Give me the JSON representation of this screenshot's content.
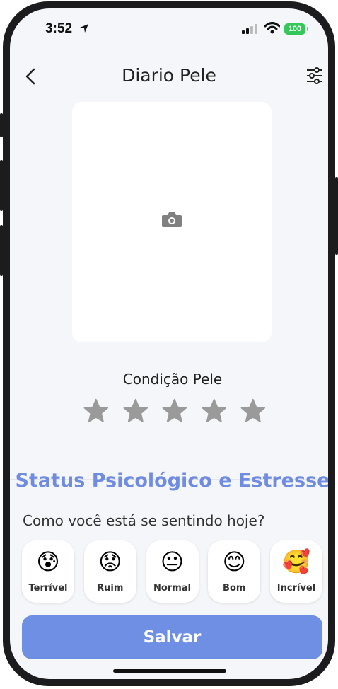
{
  "status_bar": {
    "time": "3:52",
    "battery": "100"
  },
  "header": {
    "title": "Diario Pele"
  },
  "photo": {
    "icon": "camera-icon"
  },
  "skin_condition": {
    "label": "Condição Pele",
    "stars_total": 5,
    "stars_selected": 0
  },
  "psych": {
    "title": "Status Psicológico e Estresse",
    "question": "Como você está se sentindo hoje?",
    "moods": [
      {
        "emoji": "😰",
        "label": "Terrível"
      },
      {
        "emoji": "😟",
        "label": "Ruim"
      },
      {
        "emoji": "😐",
        "label": "Normal"
      },
      {
        "emoji": "😊",
        "label": "Bom"
      },
      {
        "emoji": "🥰",
        "label": "Incrível"
      }
    ]
  },
  "actions": {
    "save_label": "Salvar"
  },
  "colors": {
    "accent": "#6e8fe3",
    "title_accent": "#6f8ce0",
    "star": "#9a9a9a",
    "battery": "#34c759"
  }
}
